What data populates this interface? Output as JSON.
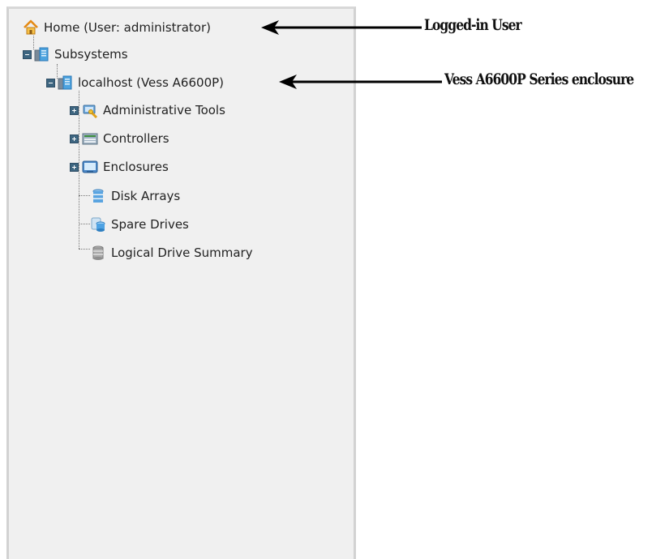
{
  "tree": {
    "home": {
      "label": "Home (User: administrator)",
      "icon": "home-icon"
    },
    "subsystems": {
      "label": "Subsystems",
      "icon": "server-icon"
    },
    "localhost": {
      "label": "localhost (Vess A6600P)",
      "icon": "server-icon"
    },
    "children": [
      {
        "label": "Administrative Tools",
        "icon": "admin-tools-icon",
        "expandable": true
      },
      {
        "label": "Controllers",
        "icon": "controller-icon",
        "expandable": true
      },
      {
        "label": "Enclosures",
        "icon": "enclosure-icon",
        "expandable": true
      },
      {
        "label": "Disk Arrays",
        "icon": "disk-array-icon",
        "expandable": false
      },
      {
        "label": "Spare Drives",
        "icon": "spare-drive-icon",
        "expandable": false
      },
      {
        "label": "Logical Drive Summary",
        "icon": "logical-drive-icon",
        "expandable": false
      }
    ]
  },
  "annotations": {
    "user": "Logged-in User",
    "enclosure": "Vess A6600P Series enclosure"
  },
  "colors": {
    "panel_bg": "#f0f0f0",
    "panel_border": "#d2d2d2",
    "toggle": "#3d6580",
    "home": "#f29a1f"
  }
}
